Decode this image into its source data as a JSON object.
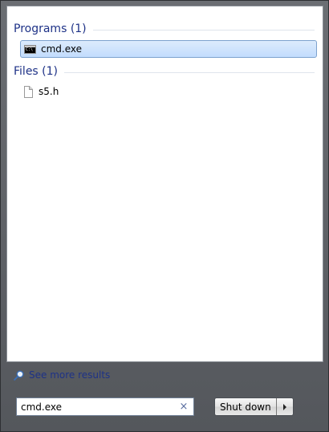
{
  "results": {
    "programs": {
      "header": "Programs (1)",
      "items": [
        {
          "label": "cmd.exe",
          "icon": "cmd-icon",
          "selected": true
        }
      ]
    },
    "files": {
      "header": "Files (1)",
      "items": [
        {
          "label": "s5.h",
          "icon": "file-icon",
          "selected": false
        }
      ]
    }
  },
  "see_more": {
    "label": "See more results",
    "icon": "magnifier-icon"
  },
  "search": {
    "value": "cmd.exe",
    "clear_icon": "×"
  },
  "shutdown": {
    "label": "Shut down",
    "arrow_icon": "triangle-right-icon"
  },
  "colors": {
    "header_text": "#1e3287",
    "selection_fill": "#c2dcfd",
    "selection_border": "#7da2ce",
    "frame": "#5c5e62"
  }
}
